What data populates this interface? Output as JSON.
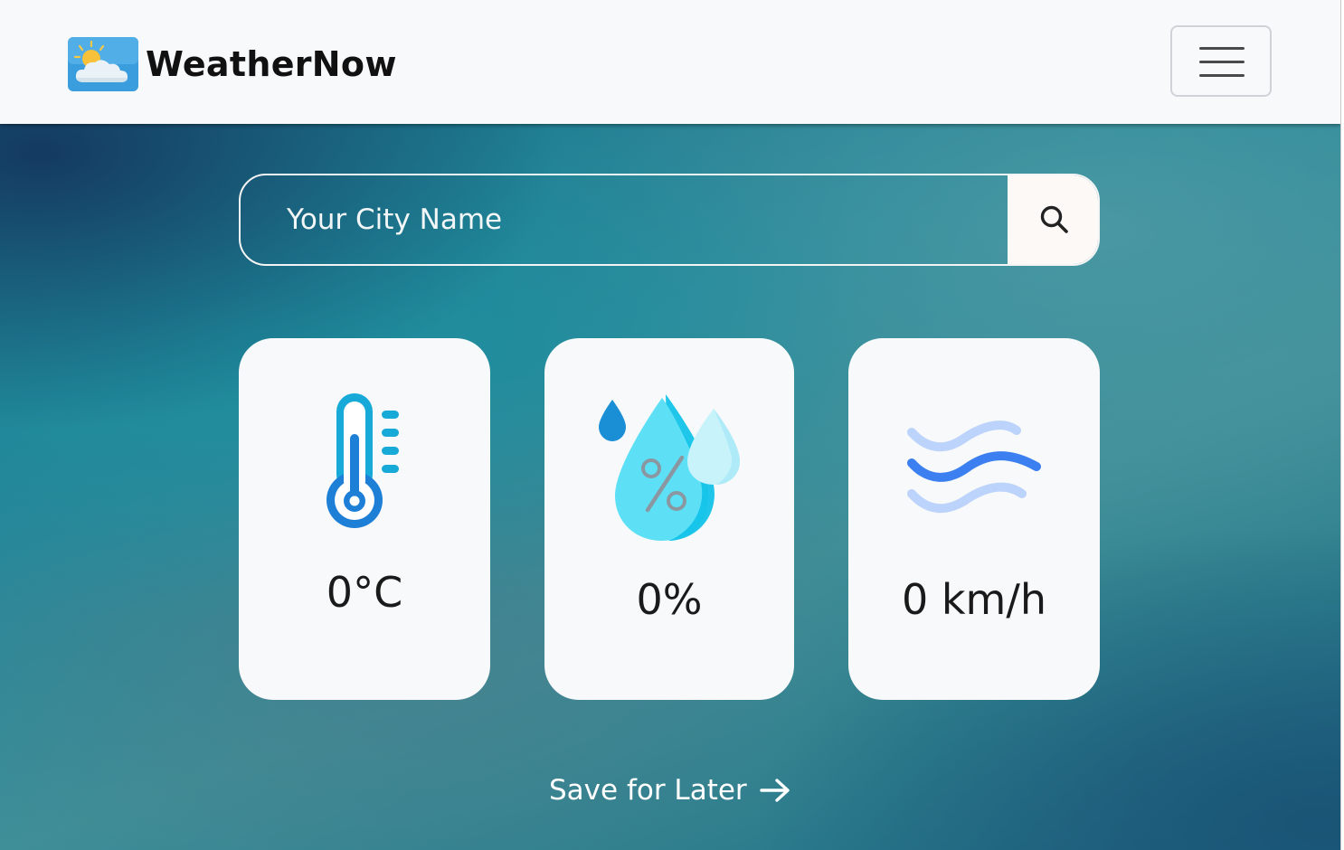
{
  "app": {
    "brand_name": "WeatherNow",
    "logo_icon": "partly-cloudy-sun-icon",
    "menu_icon": "hamburger-menu-icon"
  },
  "search": {
    "placeholder": "Your City Name",
    "value": "",
    "button_icon": "search-icon"
  },
  "cards": [
    {
      "id": "temperature",
      "icon": "thermometer-icon",
      "value": "0°C"
    },
    {
      "id": "humidity",
      "icon": "humidity-drops-icon",
      "value": "0%"
    },
    {
      "id": "wind",
      "icon": "wind-waves-icon",
      "value": "0 km/h"
    }
  ],
  "save": {
    "label": "Save for Later",
    "icon": "arrow-right-icon"
  },
  "colors": {
    "navbar_bg": "#f8f9fa",
    "card_bg": "#f8f9fa",
    "hero_accent": "#25889a",
    "thermometer_blue": "#1a8fd6",
    "drop_cyan": "#5ee0f5",
    "wind_blue": "#3b7ff0"
  }
}
